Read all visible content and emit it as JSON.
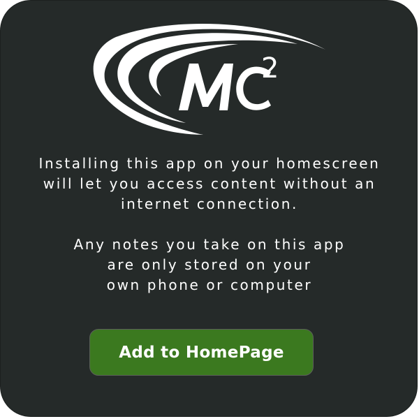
{
  "logo": {
    "text": "MC²",
    "icon": "mc2-swoosh-logo"
  },
  "messages": {
    "install_info": "Installing this app on your homescreen\nwill let you access content without an\ninternet connection.",
    "notes_info": "Any notes you take on this app\nare only stored on your\nown phone or computer"
  },
  "button": {
    "label": "Add to HomePage"
  },
  "colors": {
    "card_background": "#252a29",
    "button_background": "#3b791f",
    "text": "#ffffff"
  }
}
